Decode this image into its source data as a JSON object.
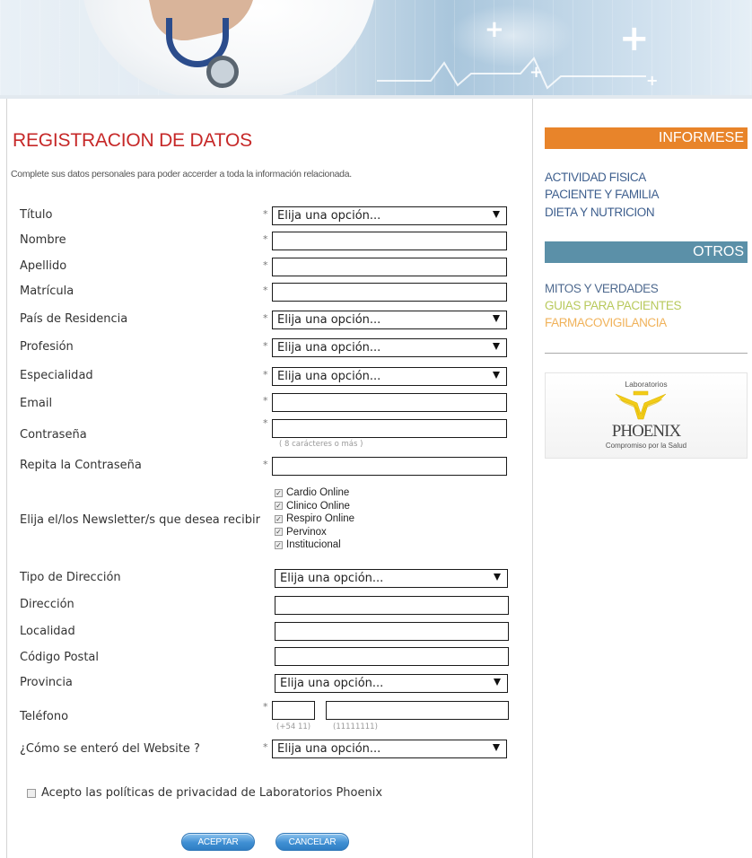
{
  "form": {
    "title": "REGISTRACION DE DATOS",
    "intro": "Complete sus datos personales para poder accerder a toda la información relacionada.",
    "required_mark": "*",
    "select_placeholder": "Elija una opción...",
    "labels": {
      "titulo": "Título",
      "nombre": "Nombre",
      "apellido": "Apellido",
      "matricula": "Matrícula",
      "pais": "País de Residencia",
      "profesion": "Profesión",
      "especialidad": "Especialidad",
      "email": "Email",
      "contrasena": "Contraseña",
      "repita": "Repita la Contraseña",
      "newsletters": "Elija el/los Newsletter/s que desea recibir",
      "tipo_direccion": "Tipo de Dirección",
      "direccion": "Dirección",
      "localidad": "Localidad",
      "codigo_postal": "Código Postal",
      "provincia": "Provincia",
      "telefono": "Teléfono",
      "como_se_entero": "¿Cómo se enteró del Website ?"
    },
    "values": {
      "titulo": "Elija una opción...",
      "pais": "Elija una opción...",
      "profesion": "Elija una opción...",
      "especialidad": "Elija una opción...",
      "tipo_direccion": "Elija una opción...",
      "provincia": "Elija una opción...",
      "como_se_entero": "Elija una opción..."
    },
    "password_hint": "( 8 carácteres o más )",
    "phone_hint_area": "(+54 11)",
    "phone_hint_number": "(11111111)",
    "newsletters": [
      {
        "label": "Cardio Online",
        "checked": true
      },
      {
        "label": "Clinico Online",
        "checked": true
      },
      {
        "label": "Respiro Online",
        "checked": true
      },
      {
        "label": "Pervinox",
        "checked": true
      },
      {
        "label": "Institucional",
        "checked": true
      }
    ],
    "privacy_label": "Acepto las políticas de privacidad de Laboratorios Phoenix",
    "privacy_checked": false,
    "accept_button": "ACEPTAR",
    "cancel_button": "CANCELAR"
  },
  "sidebar": {
    "informese_heading": "INFORMESE",
    "informese_color": "#e8842a",
    "informese_links": [
      "ACTIVIDAD FISICA",
      "PACIENTE Y FAMILIA",
      "DIETA Y NUTRICION"
    ],
    "informese_link_color": "#3e5f8e",
    "otros_heading": "OTROS",
    "otros_color": "#5b90a8",
    "otros_links": [
      {
        "label": "MITOS Y VERDADES",
        "color": "#4f6a8f"
      },
      {
        "label": "GUIAS PARA PACIENTES",
        "color": "#b8c95c"
      },
      {
        "label": "FARMACOVIGILANCIA",
        "color": "#f0b25a"
      }
    ],
    "logo": {
      "top_text": "Laboratorios",
      "name": "PHOENIX",
      "tagline": "Compromiso por la Salud",
      "mark_color": "#f2cc18"
    }
  }
}
